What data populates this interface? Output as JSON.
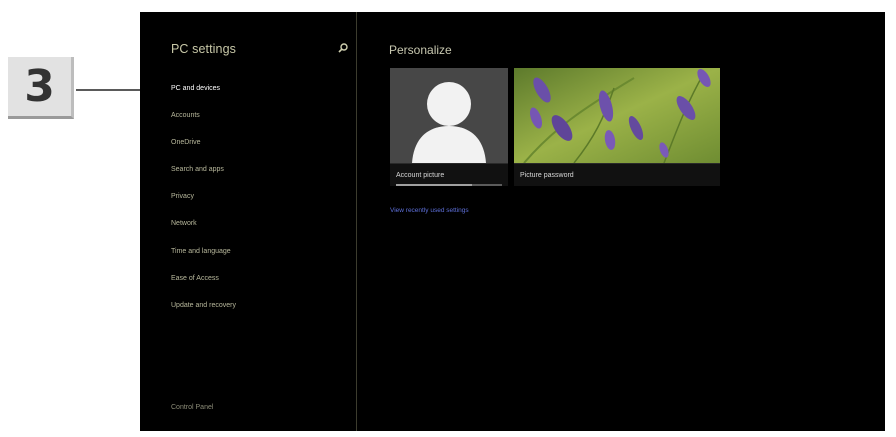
{
  "callout": {
    "number": "3"
  },
  "sidebar": {
    "title": "PC settings",
    "items": [
      {
        "label": "PC and devices",
        "active": true
      },
      {
        "label": "Accounts"
      },
      {
        "label": "OneDrive"
      },
      {
        "label": "Search and apps"
      },
      {
        "label": "Privacy"
      },
      {
        "label": "Network"
      },
      {
        "label": "Time and language"
      },
      {
        "label": "Ease of Access"
      },
      {
        "label": "Update and recovery"
      }
    ],
    "footer_link": "Control Panel"
  },
  "main": {
    "title": "Personalize",
    "tiles": [
      {
        "label": "Account picture",
        "progress": 0.72
      },
      {
        "label": "Picture password"
      }
    ],
    "link": "View recently used settings"
  },
  "colors": {
    "background": "#000000",
    "sidebar_text": "#b8b89c",
    "link": "#5d6fd8",
    "lavender_green": "#7f9b3a",
    "lavender_purple": "#6a4fa8"
  }
}
